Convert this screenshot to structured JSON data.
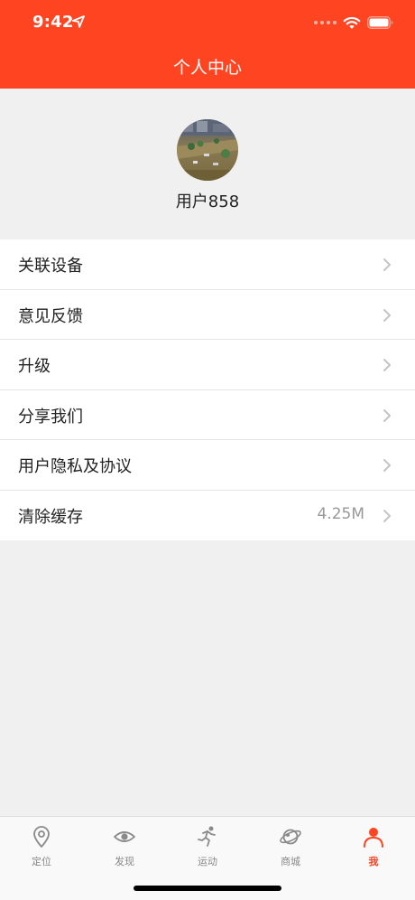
{
  "status_bar": {
    "time": "9:42"
  },
  "header": {
    "title": "个人中心"
  },
  "profile": {
    "username": "用户858"
  },
  "menu": {
    "items": [
      {
        "label": "关联设备",
        "value": ""
      },
      {
        "label": "意见反馈",
        "value": ""
      },
      {
        "label": "升级",
        "value": ""
      },
      {
        "label": "分享我们",
        "value": ""
      },
      {
        "label": "用户隐私及协议",
        "value": ""
      },
      {
        "label": "清除缓存",
        "value": "4.25M"
      }
    ]
  },
  "tabbar": {
    "tabs": [
      {
        "label": "定位",
        "icon": "location-pin-icon"
      },
      {
        "label": "发现",
        "icon": "eye-icon"
      },
      {
        "label": "运动",
        "icon": "running-person-icon"
      },
      {
        "label": "商城",
        "icon": "planet-icon"
      },
      {
        "label": "我",
        "icon": "person-icon",
        "active": true
      }
    ]
  },
  "colors": {
    "accent": "#ff4422",
    "background": "#f0f0f0",
    "text": "#222222",
    "muted": "#999999"
  }
}
